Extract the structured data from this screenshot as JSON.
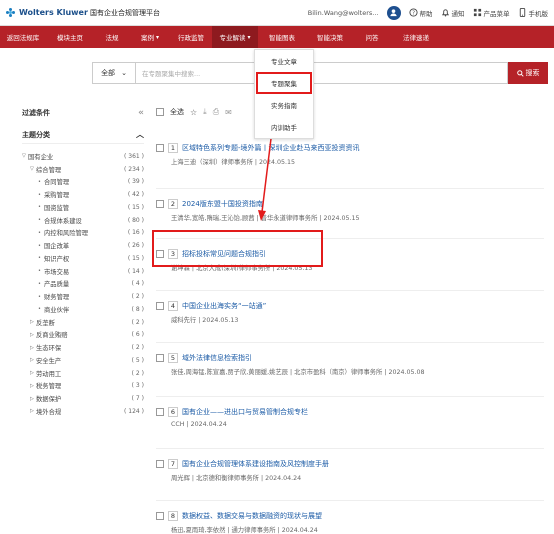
{
  "header": {
    "brand": "Wolters Kluwer",
    "platform": "国有企业合规管理平台",
    "user": "Bilin.Wang@wolters...",
    "user_icon": "user-icon",
    "help": "帮助",
    "notify": "通知",
    "features": "产品菜单",
    "mobile": "手机版"
  },
  "nav": {
    "items": [
      "返回法规库",
      "模块主页",
      "法规",
      "案例",
      "行政监管",
      "专业解读",
      "智能图表",
      "智能决策",
      "问答",
      "法律速递"
    ],
    "active_index": 5,
    "dropdown_items": [
      "专业文章",
      "专题聚集",
      "实务指南",
      "内训助手"
    ],
    "highlight_index": 1
  },
  "search": {
    "scope": "全部",
    "placeholder": "在专题聚集中搜索...",
    "button": "搜索"
  },
  "sidebar": {
    "filter_title": "过滤条件",
    "category_title": "主题分类",
    "tree": [
      {
        "label": "国有企业",
        "count": "( 361 )",
        "level": 0,
        "arrow": "▽"
      },
      {
        "label": "综合管理",
        "count": "( 234 )",
        "level": 1,
        "arrow": "▽"
      },
      {
        "label": "合同管理",
        "count": "( 39 )",
        "level": 2
      },
      {
        "label": "采购管理",
        "count": "( 42 )",
        "level": 2
      },
      {
        "label": "国资监管",
        "count": "( 15 )",
        "level": 2
      },
      {
        "label": "合规体系建设",
        "count": "( 80 )",
        "level": 2
      },
      {
        "label": "内控和风险管理",
        "count": "( 16 )",
        "level": 2
      },
      {
        "label": "国企改革",
        "count": "( 26 )",
        "level": 2
      },
      {
        "label": "知识产权",
        "count": "( 15 )",
        "level": 2
      },
      {
        "label": "市场交易",
        "count": "( 14 )",
        "level": 2
      },
      {
        "label": "产品质量",
        "count": "( 4 )",
        "level": 2
      },
      {
        "label": "财务管理",
        "count": "( 2 )",
        "level": 2
      },
      {
        "label": "商业伙伴",
        "count": "( 8 )",
        "level": 2
      },
      {
        "label": "反垄断",
        "count": "( 2 )",
        "level": 1,
        "arrow": "▷"
      },
      {
        "label": "反商业贿赂",
        "count": "( 6 )",
        "level": 1,
        "arrow": "▷"
      },
      {
        "label": "生态环保",
        "count": "( 2 )",
        "level": 1,
        "arrow": "▷"
      },
      {
        "label": "安全生产",
        "count": "( 5 )",
        "level": 1,
        "arrow": "▷"
      },
      {
        "label": "劳动用工",
        "count": "( 2 )",
        "level": 1,
        "arrow": "▷"
      },
      {
        "label": "税务管理",
        "count": "( 3 )",
        "level": 1,
        "arrow": "▷"
      },
      {
        "label": "数据保护",
        "count": "( 7 )",
        "level": 1,
        "arrow": "▷"
      },
      {
        "label": "境外合规",
        "count": "( 124 )",
        "level": 1,
        "arrow": "▷"
      }
    ]
  },
  "toolbar": {
    "select_all": "全选"
  },
  "results": [
    {
      "num": "1",
      "title": "区域特色系列专题-境外篇丨深圳企业赴马来西亚投资资讯",
      "meta": "上海三迪（深圳）律师事务所  |  2024.05.15"
    },
    {
      "num": "2",
      "title": "2024版东盟十国投资指南",
      "meta": "王清华,宽皓,隋瑞,王沁饴,顾茜  |  普华永道律师事务所  |  2024.05.15"
    },
    {
      "num": "3",
      "title": "招标投标常见问题合规指引",
      "meta": "谢坤霖  |  北京大成(深圳)律师事务所  |  2024.05.13"
    },
    {
      "num": "4",
      "title": "中国企业出海实务“一站通”",
      "meta": "威科先行  |  2024.05.13"
    },
    {
      "num": "5",
      "title": "域外法律信息检索指引",
      "meta": "张佳,周海锰,陈宣嘉,贾子欣,黄丽媛,姚艺辰  |  北京市盈科（南京）律师事务所  |  2024.05.08"
    },
    {
      "num": "6",
      "title": "国有企业——进出口与贸易管制合规专栏",
      "meta": "CCH  |  2024.04.24"
    },
    {
      "num": "7",
      "title": "国有企业合规管理体系建设指南及风控制度手册",
      "meta": "周光辉  |  北京德和衡律师事务所  |  2024.04.24"
    },
    {
      "num": "8",
      "title": "数据权益、数据交易与数据融资的现状与展望",
      "meta": "杨迅,夏雨琦,李依然  |  通力律师事务所  |  2024.04.24"
    }
  ],
  "colors": {
    "brand_red": "#b52228",
    "highlight_red": "#e21b1b",
    "link_blue": "#1a5aa5"
  }
}
